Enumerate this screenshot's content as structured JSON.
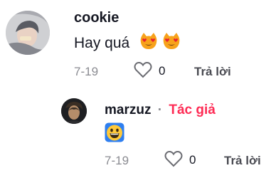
{
  "comments": [
    {
      "username": "cookie",
      "text": "Hay quá",
      "emojis": [
        "heart-eyes-cat-emoji",
        "heart-eyes-cat-emoji"
      ],
      "date": "7-19",
      "likes": "0",
      "reply_label": "Trả lời"
    },
    {
      "username": "marzuz",
      "author_tag": "Tác giả",
      "separator": "·",
      "emojis": [
        "grinning-face-emoji"
      ],
      "date": "7-19",
      "likes": "0",
      "reply_label": "Trả lời"
    }
  ],
  "colors": {
    "author_tag": "#fe2c55",
    "meta": "#8a8b91",
    "text": "#161823"
  }
}
